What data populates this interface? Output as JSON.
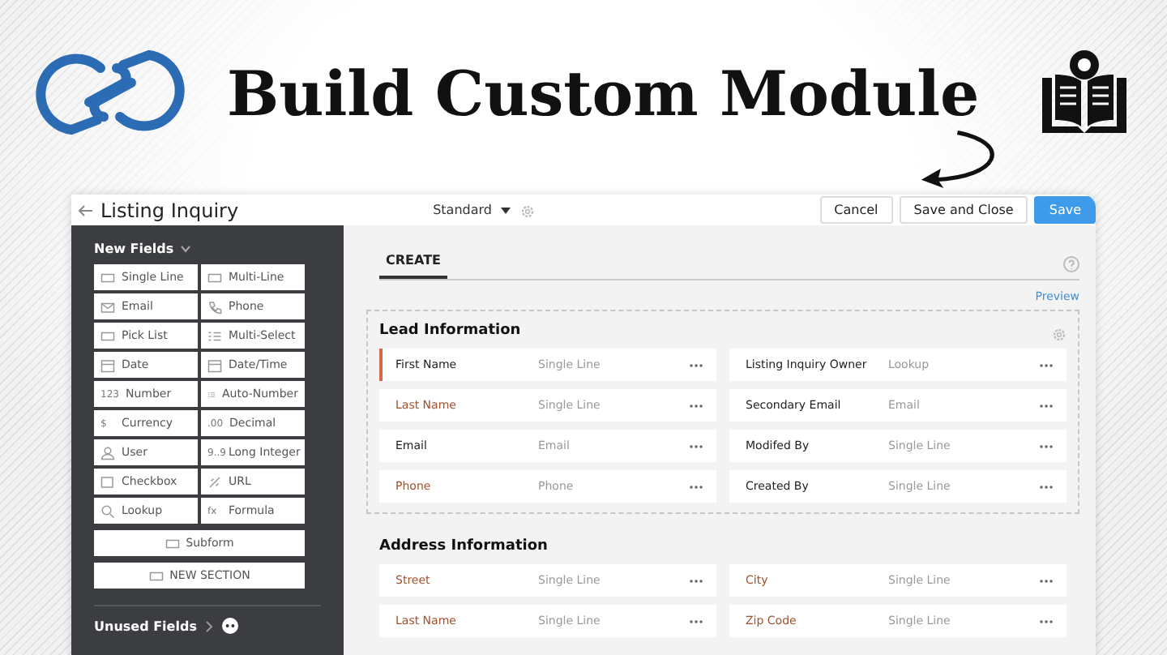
{
  "banner": {
    "title": "Build Custom Module"
  },
  "app": {
    "title": "Listing Inquiry",
    "layout": "Standard",
    "buttons": [
      {
        "label": "Cancel",
        "kind": "plain"
      },
      {
        "label": "Save and Close",
        "kind": "plain"
      },
      {
        "label": "Save",
        "kind": "primary"
      }
    ]
  },
  "sidebar": {
    "heading": "New Fields",
    "fields": [
      {
        "label": "Single Line"
      },
      {
        "label": "Multi-Line"
      },
      {
        "label": "Email"
      },
      {
        "label": "Phone"
      },
      {
        "label": "Pick List"
      },
      {
        "label": "Multi-Select"
      },
      {
        "label": "Date"
      },
      {
        "label": "Date/Time"
      },
      {
        "label": "Number",
        "glyph": "123"
      },
      {
        "label": "Auto-Number"
      },
      {
        "label": "Currency",
        "glyph": "$"
      },
      {
        "label": "Decimal",
        "glyph": ".00"
      },
      {
        "label": "User"
      },
      {
        "label": "Long Integer",
        "glyph": "9..9"
      },
      {
        "label": "Checkbox"
      },
      {
        "label": "URL"
      },
      {
        "label": "Lookup"
      },
      {
        "label": "Formula",
        "glyph": "fx"
      }
    ],
    "wide": [
      "Subform",
      "NEW SECTION"
    ],
    "unused": "Unused Fields"
  },
  "tabs": [
    {
      "label": "CREATE",
      "selected": true
    }
  ],
  "preview": "Preview",
  "sections": [
    {
      "title": "Lead Information",
      "dashed": true,
      "fields": [
        {
          "label": "First Name",
          "type": "Single Line",
          "required": false,
          "selected": true
        },
        {
          "label": "Listing Inquiry Owner",
          "type": "Lookup",
          "required": false,
          "selected": false
        },
        {
          "label": "Last Name",
          "type": "Single Line",
          "required": true,
          "selected": false
        },
        {
          "label": "Secondary Email",
          "type": "Email",
          "required": false,
          "selected": false
        },
        {
          "label": "Email",
          "type": "Email",
          "required": false,
          "selected": false
        },
        {
          "label": "Modifed By",
          "type": "Single Line",
          "required": false,
          "selected": false
        },
        {
          "label": "Phone",
          "type": "Phone",
          "required": true,
          "selected": false
        },
        {
          "label": "Created By",
          "type": "Single Line",
          "required": false,
          "selected": false
        }
      ]
    },
    {
      "title": "Address Information",
      "dashed": false,
      "fields": [
        {
          "label": "Street",
          "type": "Single Line",
          "required": true,
          "selected": false
        },
        {
          "label": "City",
          "type": "Single Line",
          "required": true,
          "selected": false
        },
        {
          "label": "Last Name",
          "type": "Single Line",
          "required": true,
          "selected": false
        },
        {
          "label": "Zip Code",
          "type": "Single Line",
          "required": true,
          "selected": false
        }
      ]
    }
  ]
}
